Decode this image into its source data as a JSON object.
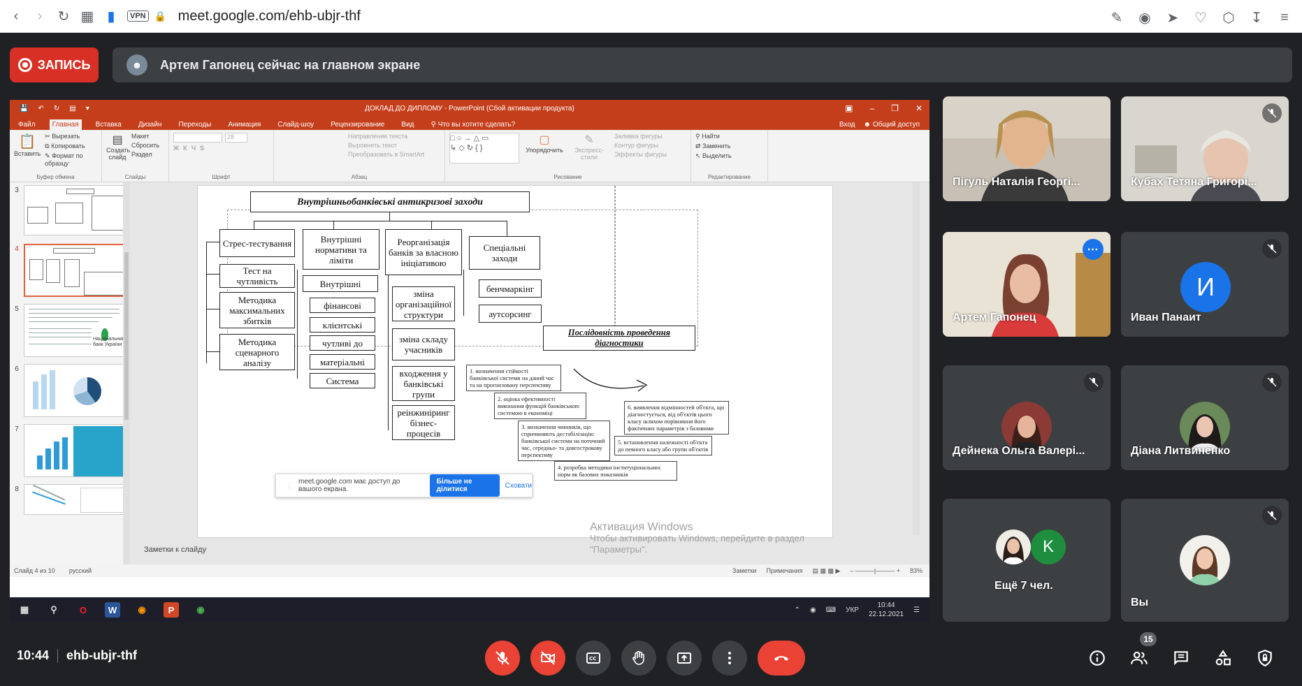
{
  "browser": {
    "url": "meet.google.com/ehb-ubjr-thf",
    "vpn_label": "VPN"
  },
  "recording": {
    "label": "ЗАПИСЬ"
  },
  "presenting_banner": {
    "text": "Артем Гапонец сейчас на главном экране"
  },
  "powerpoint": {
    "window_title": "ДОКЛАД ДО ДИПЛОМУ - PowerPoint (Сбой активации продукта)",
    "tabs": [
      "Файл",
      "Главная",
      "Вставка",
      "Дизайн",
      "Переходы",
      "Анимация",
      "Слайд-шоу",
      "Рецензирование",
      "Вид"
    ],
    "tell_me": "Что вы хотите сделать?",
    "sign_in": "Вход",
    "share": "Общий доступ",
    "ribbon": {
      "paste": "Вставить",
      "cut": "Вырезать",
      "copy": "Копировать",
      "format_painter": "Формат по образцу",
      "clipboard": "Буфер обмена",
      "new_slide": "Создать слайд",
      "layout": "Макет",
      "reset": "Сбросить",
      "section": "Раздел",
      "slides": "Слайды",
      "font_size": "28",
      "font": "Шрифт",
      "text_direction": "Направление текста",
      "align_text": "Выровнять текст",
      "smartart": "Преобразовать в SmartArt",
      "paragraph": "Абзац",
      "arrange": "Упорядочить",
      "quick_styles": "Экспресс-стили",
      "shape_fill": "Заливка фигуры",
      "shape_outline": "Контур фигуры",
      "shape_effects": "Эффекты фигуры",
      "drawing": "Рисование",
      "find": "Найти",
      "replace": "Заменить",
      "select": "Выделить",
      "editing": "Редактирование"
    },
    "thumbnails": [
      "3",
      "4",
      "5",
      "6",
      "7",
      "8"
    ],
    "nbu_thumb_text": "Національний банк України",
    "notes_placeholder": "Заметки к слайду",
    "status": {
      "slide_info": "Слайд 4 из 10",
      "language": "русский",
      "notes": "Заметки",
      "comments": "Примечания",
      "zoom": "83%"
    },
    "slide": {
      "title": "Внутрішньобанківські антикризові заходи",
      "col1": [
        "Стрес-тестування",
        "Тест на чутливість",
        "Методика максимальних збитків",
        "Методика сценарного аналізу"
      ],
      "col2_head": "Внутрішні нормативи та ліміти",
      "col2_sub_head": "Внутрішні",
      "col2": [
        "фінансові",
        "клієнтські",
        "чутливі до",
        "матеріальні",
        "Система"
      ],
      "col3_head": "Реорганізація банків за власною ініціативою",
      "col3": [
        "зміна організаційної структури",
        "зміна складу учасників",
        "входження у банківські групи",
        "реінжиніринг бізнес-процесів"
      ],
      "col4_head": "Спеціальні заходи",
      "col4": [
        "бенчмаркінг",
        "аутсорсинг"
      ],
      "sequence_title": "Послідовність проведення діагностики",
      "steps": [
        "1. визначення стійкості банківської системи на даний час та на прогнозовану перспективу",
        "2. оцінка ефективності виконання функцій банківською системою в економіці",
        "3. визначення чинників, що спричиняють дестабілізацію банківської системи на поточний час, середньо- та довгострокову перспективу",
        "4. розробка методики інституціональних норм як базових показників",
        "5. встановлення належності об'єкта до певного класу або групи об'єктів",
        "6. виявлення відмінностей об'єкта, що діагностується, від об'єктів цього класу шляхом порівняння його фактичних параметрів з базовими"
      ]
    },
    "activation_watermark": {
      "line1": "Активация Windows",
      "line2": "Чтобы активировать Windows, перейдите в раздел",
      "line3": "\"Параметры\"."
    }
  },
  "share_notice": {
    "text": "meet.google.com має доступ до вашого екрана.",
    "stop": "Більше не ділитися",
    "hide": "Сховати"
  },
  "taskbar": {
    "lang": "УКР",
    "time": "10:44",
    "date": "22.12.2021"
  },
  "participants": [
    {
      "name": "Пігуль Наталія Георгі...",
      "muted": false
    },
    {
      "name": "Кубах Тетяна Григорі...",
      "muted": true
    },
    {
      "name": "Артем Гапонец",
      "muted": false
    },
    {
      "name": "Иван Панаит",
      "muted": true,
      "initial": "И"
    },
    {
      "name": "Дейнека Ольга Валері...",
      "muted": true
    },
    {
      "name": "Діана Литвиненко",
      "muted": true
    },
    {
      "name": "Ещё 7 чел.",
      "initial": "K"
    },
    {
      "name": "Вы",
      "muted": true
    }
  ],
  "meeting": {
    "time": "10:44",
    "code": "ehb-ubjr-thf",
    "participant_count": "15"
  },
  "colors": {
    "meet_bg": "#202124",
    "tile_bg": "#3c4043",
    "red": "#ea4335",
    "blue": "#1a73e8",
    "ppt_red": "#c43e1c"
  }
}
